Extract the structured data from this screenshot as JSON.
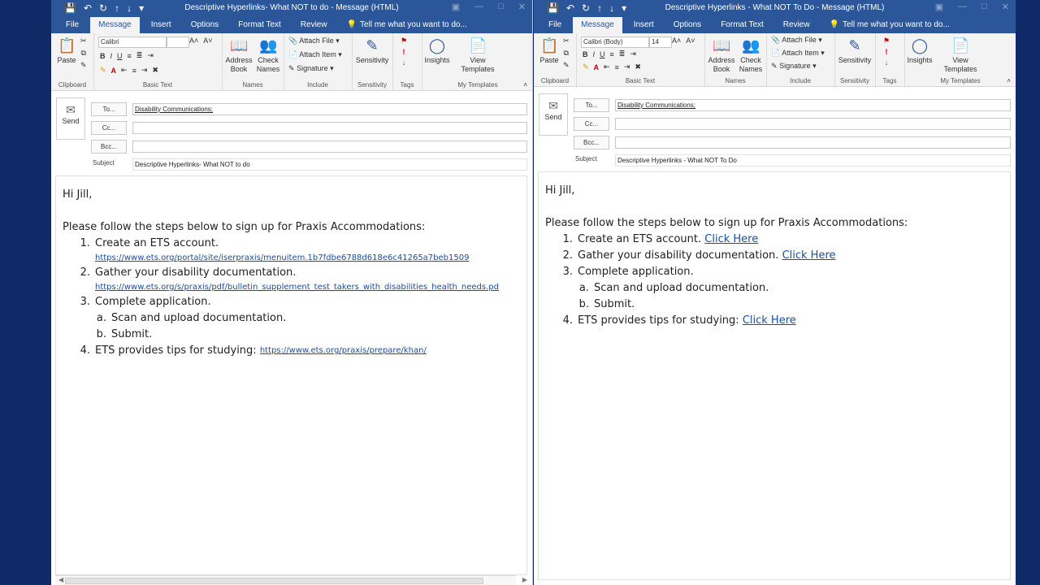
{
  "ribbon_labels": {
    "tabs": [
      "File",
      "Message",
      "Insert",
      "Options",
      "Format Text",
      "Review"
    ],
    "tell_me": "Tell me what you want to do...",
    "paste": "Paste",
    "clipboard": "Clipboard",
    "basic_text": "Basic Text",
    "address_book_l1": "Address",
    "address_book_l2": "Book",
    "check_names_l1": "Check",
    "check_names_l2": "Names",
    "names": "Names",
    "attach_file": "Attach File",
    "attach_item": "Attach Item",
    "signature": "Signature",
    "include": "Include",
    "sensitivity": "Sensitivity",
    "tags": "Tags",
    "insights": "Insights",
    "view_templates_l1": "View",
    "view_templates_l2": "Templates",
    "my_templates": "My Templates",
    "bold": "B",
    "italic": "I",
    "underline": "U",
    "font_color": "A"
  },
  "header_labels": {
    "send": "Send",
    "to": "To...",
    "cc": "Cc...",
    "bcc": "Bcc...",
    "subject": "Subject"
  },
  "colors": {
    "accent": "#2b579a",
    "desktop": "#0f2a66",
    "link": "#1a4fa0"
  },
  "left": {
    "title": "Descriptive Hyperlinks- What NOT to do - Message (HTML)",
    "font_name": "Calibri",
    "font_size": "",
    "to_value": "Disability Communications;",
    "subject_value": "Descriptive Hyperlinks- What NOT to do",
    "greeting": "Hi Jill,",
    "intro": "Please follow the steps below to sign up for Praxis Accommodations:",
    "items": [
      {
        "num": "1.",
        "text": "Create an ETS account.",
        "url": "https://www.ets.org/portal/site/iserpraxis/menuitem.1b7fdbe6788d618e6c41265a7beb1509"
      },
      {
        "num": "2.",
        "text": "Gather your disability documentation.",
        "url": "https://www.ets.org/s/praxis/pdf/bulletin_supplement_test_takers_with_disabilities_health_needs.pd"
      },
      {
        "num": "3.",
        "text": "Complete application."
      },
      {
        "num": "4.",
        "text": "ETS provides tips for studying: ",
        "link": "https://www.ets.org/praxis/prepare/khan/"
      }
    ],
    "subitems": [
      {
        "num": "a.",
        "text": "Scan and upload documentation."
      },
      {
        "num": "b.",
        "text": "Submit."
      }
    ]
  },
  "right": {
    "title": "Descriptive Hyperlinks - What NOT To Do - Message (HTML)",
    "font_name": "Calibri (Body)",
    "font_size": "14",
    "to_value": "Disability Communications;",
    "subject_value": "Descriptive Hyperlinks - What NOT To Do",
    "greeting": "Hi Jill,",
    "intro": "Please follow the steps below to sign up for Praxis Accommodations:",
    "items": [
      {
        "num": "1.",
        "text": "Create an ETS account. ",
        "link": "Click Here"
      },
      {
        "num": "2.",
        "text": "Gather your disability documentation. ",
        "link": "Click Here"
      },
      {
        "num": "3.",
        "text": "Complete application."
      },
      {
        "num": "4.",
        "text": "ETS provides tips for studying: ",
        "link": "Click Here"
      }
    ],
    "subitems": [
      {
        "num": "a.",
        "text": "Scan and upload documentation."
      },
      {
        "num": "b.",
        "text": "Submit."
      }
    ]
  }
}
